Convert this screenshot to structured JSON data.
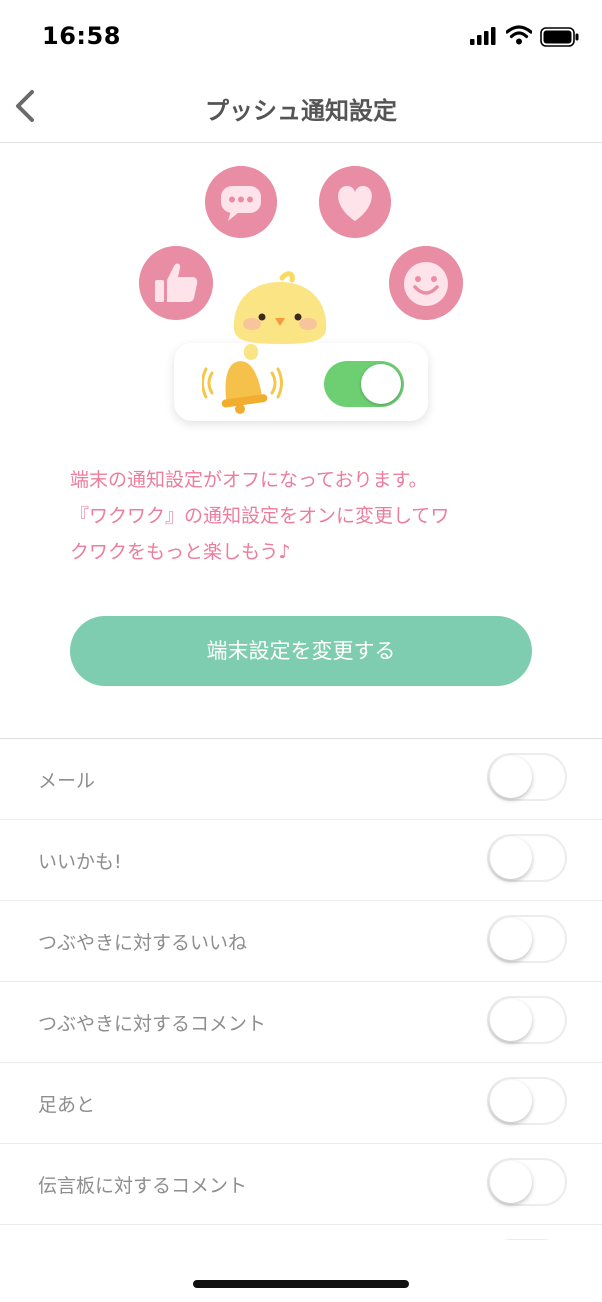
{
  "status": {
    "time": "16:58"
  },
  "nav": {
    "title": "プッシュ通知設定",
    "back_icon": "chevron-left-icon"
  },
  "hero": {
    "icons": [
      "chat-bubble-icon",
      "heart-icon",
      "thumbs-up-icon",
      "smile-icon",
      "chick-mascot",
      "bell-icon"
    ],
    "sample_toggle_on": true,
    "colors": {
      "bubble": "#e98da5",
      "toggle_on": "#6dcf72"
    }
  },
  "message": {
    "lines": [
      "端末の通知設定がオフになっております。",
      "『ワクワク』の通知設定をオンに変更してワ",
      "クワクをもっと楽しもう♪"
    ],
    "color": "#ec7d9d"
  },
  "button": {
    "label": "端末設定を変更する",
    "color": "#7fcdb0"
  },
  "settings": {
    "items": [
      {
        "label": "メール",
        "on": false
      },
      {
        "label": "いいかも!",
        "on": false
      },
      {
        "label": "つぶやきに対するいいね",
        "on": false
      },
      {
        "label": "つぶやきに対するコメント",
        "on": false
      },
      {
        "label": "足あと",
        "on": false
      },
      {
        "label": "伝言板に対するコメント",
        "on": false
      }
    ]
  }
}
